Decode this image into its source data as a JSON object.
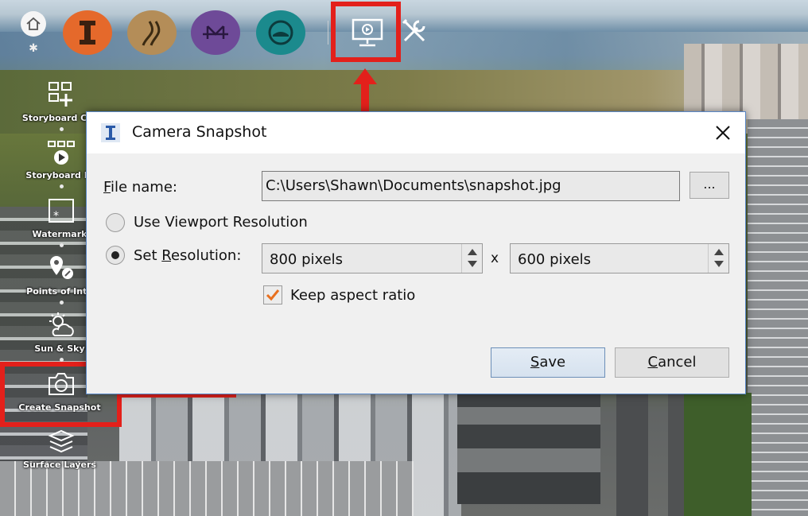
{
  "toolbar": {
    "icons": [
      "home-icon",
      "settings-icon",
      "infrastructure-icon",
      "road-icon",
      "bridge-icon",
      "tunnel-icon",
      "presentation-monitor-icon",
      "tools-icon"
    ]
  },
  "sidebar": {
    "items": [
      {
        "label": "Storyboard Cre",
        "icon": "storyboard-create-icon"
      },
      {
        "label": "Storyboard Pl",
        "icon": "storyboard-play-icon"
      },
      {
        "label": "Watermark",
        "icon": "watermark-icon"
      },
      {
        "label": "Points of Inte",
        "icon": "points-of-interest-icon"
      },
      {
        "label": "Sun & Sky",
        "icon": "sun-sky-icon"
      },
      {
        "label": "Create Snapshot",
        "icon": "camera-icon"
      },
      {
        "label": "Surface Layers",
        "icon": "layers-icon"
      }
    ]
  },
  "dialog": {
    "title": "Camera Snapshot",
    "file_label_first": "F",
    "file_label_rest": "ile name:",
    "file_value": "C:\\Users\\Shawn\\Documents\\snapshot.jpg",
    "browse_label": "...",
    "viewport_option": "Use Viewport Resolution",
    "set_res_prefix": "Set ",
    "set_res_underlined": "R",
    "set_res_rest": "esolution:",
    "width_value": "800 pixels",
    "times": "x",
    "height_value": "600 pixels",
    "keep_aspect": "Keep aspect ratio",
    "save_first": "S",
    "save_rest": "ave",
    "cancel_first": "C",
    "cancel_rest": "ancel",
    "selected_option": "set_resolution",
    "keep_aspect_checked": true
  },
  "colors": {
    "highlight": "#e3201b",
    "infra": "#e5692b",
    "road": "#b48d58",
    "bridge": "#6e4a98",
    "tunnel": "#1b8a8d",
    "check": "#e8701f"
  }
}
